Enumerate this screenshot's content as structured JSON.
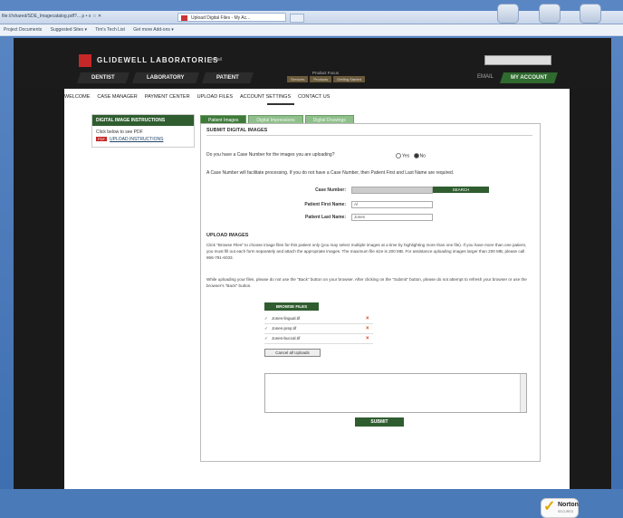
{
  "browser": {
    "url": "file:///shared/SDE_Imagecatalog.pdf?...   ρ • ≡ ☆ ✕",
    "tab_title": "Upload Digital Files - My Ac...",
    "favorites": [
      "Project Documents",
      "Suggested Sites ▾",
      "Tim's Tech List",
      "Get more Add-ons ▾"
    ]
  },
  "site": {
    "logo": "GLIDEWELL LABORATORIES",
    "logo_sub": "▸ email",
    "categories": [
      "DENTIST",
      "LABORATORY",
      "PATIENT"
    ],
    "subnav_label": "Product Focus",
    "subnav": [
      "Services",
      "Products",
      "Getting Started"
    ],
    "email": "EMAIL",
    "my_account": "MY ACCOUNT"
  },
  "main_nav": [
    "WELCOME",
    "CASE MANAGER",
    "PAYMENT CENTER",
    "UPLOAD FILES",
    "ACCOUNT SETTINGS",
    "CONTACT US"
  ],
  "sidebar": {
    "title": "DIGITAL IMAGE INSTRUCTIONS",
    "text": "Click below to see PDF",
    "pdf_badge": "PDF",
    "link": "UPLOAD INSTRUCTIONS"
  },
  "tabs": [
    "Patient Images",
    "Digital Impressions",
    "Digital Drawings"
  ],
  "form": {
    "title": "SUBMIT DIGITAL IMAGES",
    "question": "Do you have a Case Number for the images you are uploading?",
    "yes": "Yes",
    "no": "No",
    "note": "A Case Number will facilitate processing. If you do not have a Case Number, then Patient First and Last Name are required.",
    "case_label": "Case Number:",
    "case_value": "",
    "case_search": "SEARCH",
    "first_label": "Patient First Name:",
    "first_value": "Al",
    "last_label": "Patient Last Name:",
    "last_value": "Jones"
  },
  "upload": {
    "title": "UPLOAD IMAGES",
    "para1": "Click \"Browse Files\" to choose image files for this patient only (you may select multiple images at a time by highlighting more than one file). If you have more than one patient, you must fill out each form separately and attach the appropriate images. The maximum file size is 200 MB. For assistance uploading images larger than 200 MB, please call 866-791-6033.",
    "para2": "While uploading your files, please do not use the \"Back\" button on your browser. After clicking on the \"Submit\" button, please do not attempt to refresh your browser or use the browser's \"Back\" button.",
    "browse": "BROWSE FILES",
    "files": [
      "Jones-lingual.tif",
      "Jones-prep.tif",
      "Jones-buccal.tif"
    ],
    "cancel_all": "Cancel all Uploads",
    "submit": "SUBMIT"
  },
  "norton": {
    "name": "Norton",
    "sub": "SECURED",
    "sub2": "powered by VeriSign"
  }
}
